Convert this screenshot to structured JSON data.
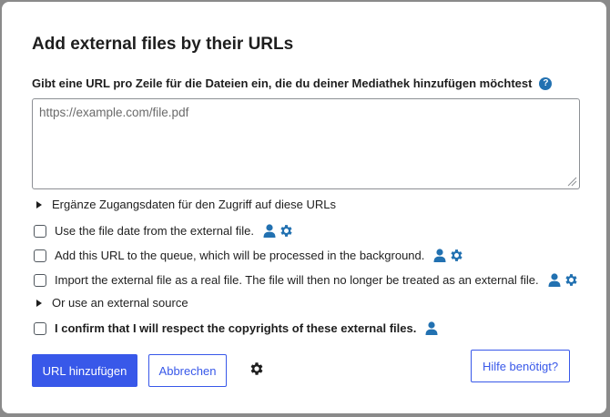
{
  "dialog": {
    "title": "Add external files by their URLs",
    "url_label": "Gibt eine URL pro Zeile für die Dateien ein, die du deiner Mediathek hinzufügen möchtest",
    "help_icon_text": "?",
    "url_placeholder": "https://example.com/file.pdf"
  },
  "options": {
    "credentials_toggle": "Ergänze Zugangsdaten für den Zugriff auf diese URLs",
    "use_file_date": "Use the file date from the external file.",
    "add_to_queue": "Add this URL to the queue, which will be processed in the background.",
    "import_real_file": "Import the external file as a real file. The file will then no longer be treated as an external file.",
    "external_source_toggle": "Or use an external source",
    "confirm_copyright": "I confirm that I will respect the copyrights of these external files."
  },
  "actions": {
    "add_url_label": "URL hinzufügen",
    "cancel_label": "Abbrechen",
    "help_label": "Hilfe benötigt?"
  },
  "icons": {
    "user": "user-icon",
    "gear": "gear-icon",
    "help": "help-icon",
    "toggle": "triangle-right-icon"
  },
  "colors": {
    "accent": "#3858e9",
    "icon_blue": "#2271b1"
  }
}
